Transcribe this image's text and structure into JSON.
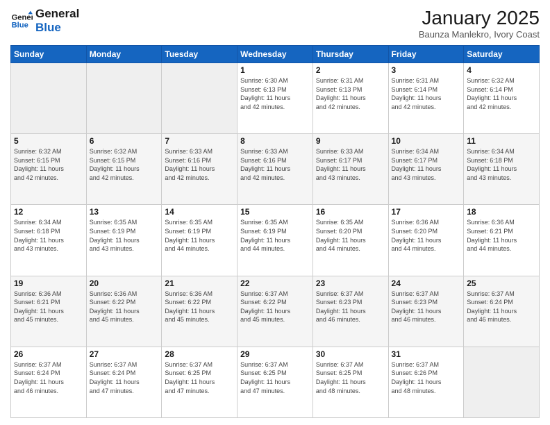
{
  "header": {
    "logo_line1": "General",
    "logo_line2": "Blue",
    "month_year": "January 2025",
    "subtitle": "Baunza Manlekro, Ivory Coast"
  },
  "days_of_week": [
    "Sunday",
    "Monday",
    "Tuesday",
    "Wednesday",
    "Thursday",
    "Friday",
    "Saturday"
  ],
  "weeks": [
    [
      {
        "day": "",
        "info": ""
      },
      {
        "day": "",
        "info": ""
      },
      {
        "day": "",
        "info": ""
      },
      {
        "day": "1",
        "info": "Sunrise: 6:30 AM\nSunset: 6:13 PM\nDaylight: 11 hours\nand 42 minutes."
      },
      {
        "day": "2",
        "info": "Sunrise: 6:31 AM\nSunset: 6:13 PM\nDaylight: 11 hours\nand 42 minutes."
      },
      {
        "day": "3",
        "info": "Sunrise: 6:31 AM\nSunset: 6:14 PM\nDaylight: 11 hours\nand 42 minutes."
      },
      {
        "day": "4",
        "info": "Sunrise: 6:32 AM\nSunset: 6:14 PM\nDaylight: 11 hours\nand 42 minutes."
      }
    ],
    [
      {
        "day": "5",
        "info": "Sunrise: 6:32 AM\nSunset: 6:15 PM\nDaylight: 11 hours\nand 42 minutes."
      },
      {
        "day": "6",
        "info": "Sunrise: 6:32 AM\nSunset: 6:15 PM\nDaylight: 11 hours\nand 42 minutes."
      },
      {
        "day": "7",
        "info": "Sunrise: 6:33 AM\nSunset: 6:16 PM\nDaylight: 11 hours\nand 42 minutes."
      },
      {
        "day": "8",
        "info": "Sunrise: 6:33 AM\nSunset: 6:16 PM\nDaylight: 11 hours\nand 42 minutes."
      },
      {
        "day": "9",
        "info": "Sunrise: 6:33 AM\nSunset: 6:17 PM\nDaylight: 11 hours\nand 43 minutes."
      },
      {
        "day": "10",
        "info": "Sunrise: 6:34 AM\nSunset: 6:17 PM\nDaylight: 11 hours\nand 43 minutes."
      },
      {
        "day": "11",
        "info": "Sunrise: 6:34 AM\nSunset: 6:18 PM\nDaylight: 11 hours\nand 43 minutes."
      }
    ],
    [
      {
        "day": "12",
        "info": "Sunrise: 6:34 AM\nSunset: 6:18 PM\nDaylight: 11 hours\nand 43 minutes."
      },
      {
        "day": "13",
        "info": "Sunrise: 6:35 AM\nSunset: 6:19 PM\nDaylight: 11 hours\nand 43 minutes."
      },
      {
        "day": "14",
        "info": "Sunrise: 6:35 AM\nSunset: 6:19 PM\nDaylight: 11 hours\nand 44 minutes."
      },
      {
        "day": "15",
        "info": "Sunrise: 6:35 AM\nSunset: 6:19 PM\nDaylight: 11 hours\nand 44 minutes."
      },
      {
        "day": "16",
        "info": "Sunrise: 6:35 AM\nSunset: 6:20 PM\nDaylight: 11 hours\nand 44 minutes."
      },
      {
        "day": "17",
        "info": "Sunrise: 6:36 AM\nSunset: 6:20 PM\nDaylight: 11 hours\nand 44 minutes."
      },
      {
        "day": "18",
        "info": "Sunrise: 6:36 AM\nSunset: 6:21 PM\nDaylight: 11 hours\nand 44 minutes."
      }
    ],
    [
      {
        "day": "19",
        "info": "Sunrise: 6:36 AM\nSunset: 6:21 PM\nDaylight: 11 hours\nand 45 minutes."
      },
      {
        "day": "20",
        "info": "Sunrise: 6:36 AM\nSunset: 6:22 PM\nDaylight: 11 hours\nand 45 minutes."
      },
      {
        "day": "21",
        "info": "Sunrise: 6:36 AM\nSunset: 6:22 PM\nDaylight: 11 hours\nand 45 minutes."
      },
      {
        "day": "22",
        "info": "Sunrise: 6:37 AM\nSunset: 6:22 PM\nDaylight: 11 hours\nand 45 minutes."
      },
      {
        "day": "23",
        "info": "Sunrise: 6:37 AM\nSunset: 6:23 PM\nDaylight: 11 hours\nand 46 minutes."
      },
      {
        "day": "24",
        "info": "Sunrise: 6:37 AM\nSunset: 6:23 PM\nDaylight: 11 hours\nand 46 minutes."
      },
      {
        "day": "25",
        "info": "Sunrise: 6:37 AM\nSunset: 6:24 PM\nDaylight: 11 hours\nand 46 minutes."
      }
    ],
    [
      {
        "day": "26",
        "info": "Sunrise: 6:37 AM\nSunset: 6:24 PM\nDaylight: 11 hours\nand 46 minutes."
      },
      {
        "day": "27",
        "info": "Sunrise: 6:37 AM\nSunset: 6:24 PM\nDaylight: 11 hours\nand 47 minutes."
      },
      {
        "day": "28",
        "info": "Sunrise: 6:37 AM\nSunset: 6:25 PM\nDaylight: 11 hours\nand 47 minutes."
      },
      {
        "day": "29",
        "info": "Sunrise: 6:37 AM\nSunset: 6:25 PM\nDaylight: 11 hours\nand 47 minutes."
      },
      {
        "day": "30",
        "info": "Sunrise: 6:37 AM\nSunset: 6:25 PM\nDaylight: 11 hours\nand 48 minutes."
      },
      {
        "day": "31",
        "info": "Sunrise: 6:37 AM\nSunset: 6:26 PM\nDaylight: 11 hours\nand 48 minutes."
      },
      {
        "day": "",
        "info": ""
      }
    ]
  ]
}
